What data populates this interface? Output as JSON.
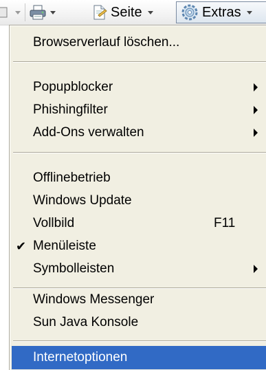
{
  "toolbar": {
    "print_icon": "printer-icon",
    "page_label": "Seite",
    "page_icon": "page-icon",
    "extras_label": "Extras",
    "extras_icon": "gear-icon"
  },
  "menu": {
    "items": [
      {
        "label": "Browserverlauf löschen..."
      },
      {
        "label": "Popupblocker",
        "submenu": true
      },
      {
        "label": "Phishingfilter",
        "submenu": true
      },
      {
        "label": "Add-Ons verwalten",
        "submenu": true
      },
      {
        "label": "Offlinebetrieb"
      },
      {
        "label": "Windows Update"
      },
      {
        "label": "Vollbild",
        "shortcut": "F11"
      },
      {
        "label": "Menüleiste",
        "checked": true
      },
      {
        "label": "Symbolleisten",
        "submenu": true
      },
      {
        "label": "Windows Messenger"
      },
      {
        "label": "Sun Java Konsole"
      },
      {
        "label": "Internetoptionen",
        "selected": true
      }
    ]
  },
  "colors": {
    "menu_background": "#f1efe2",
    "selection": "#316ac5",
    "separator": "#aca899"
  }
}
